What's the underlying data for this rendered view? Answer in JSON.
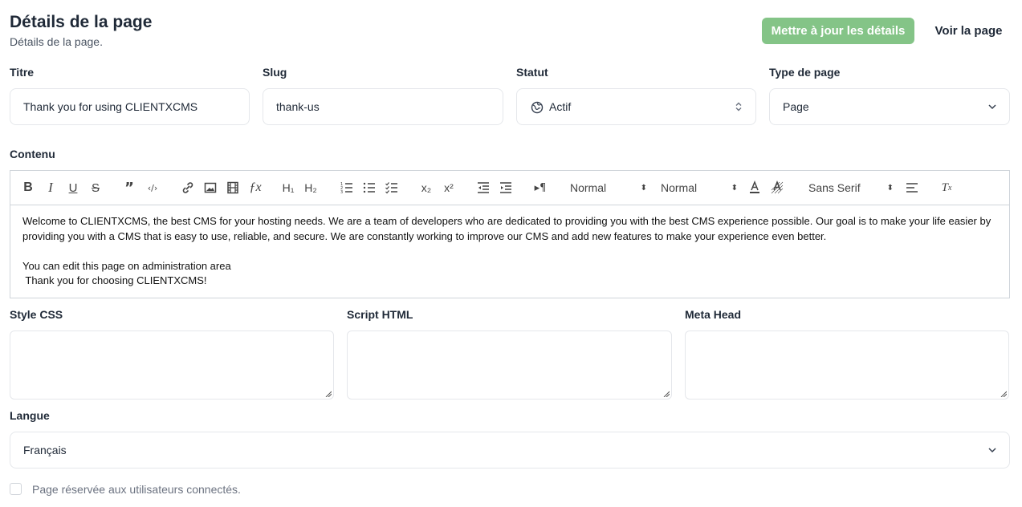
{
  "header": {
    "title": "Détails de la page",
    "subtitle": "Détails de la page.",
    "update_button": "Mettre à jour les détails",
    "view_button": "Voir la page"
  },
  "fields": {
    "title": {
      "label": "Titre",
      "value": "Thank you for using CLIENTXCMS"
    },
    "slug": {
      "label": "Slug",
      "value": "thank-us"
    },
    "status": {
      "label": "Statut",
      "value": "Actif"
    },
    "page_type": {
      "label": "Type de page",
      "value": "Page"
    }
  },
  "content": {
    "label": "Contenu",
    "toolbar": {
      "header_select": "Normal",
      "size_select": "Normal",
      "font_select": "Sans Serif"
    },
    "paragraphs": [
      "Welcome to CLIENTXCMS, the best CMS for your hosting needs. We are a team of developers who are dedicated to providing you with the best CMS experience possible. Our goal is to make your life easier by providing you with a CMS that is easy to use, reliable, and secure. We are constantly working to improve our CMS and add new features to make your experience even better.",
      "",
      "You can edit this page on administration area",
      " Thank you for choosing CLIENTXCMS!"
    ]
  },
  "extras": {
    "css_label": "Style CSS",
    "script_label": "Script HTML",
    "meta_label": "Meta Head"
  },
  "language": {
    "label": "Langue",
    "value": "Français"
  },
  "checkbox": {
    "label": "Page réservée aux utilisateurs connectés."
  },
  "colors": {
    "primary": "#84c487",
    "border": "#e5e7eb"
  }
}
